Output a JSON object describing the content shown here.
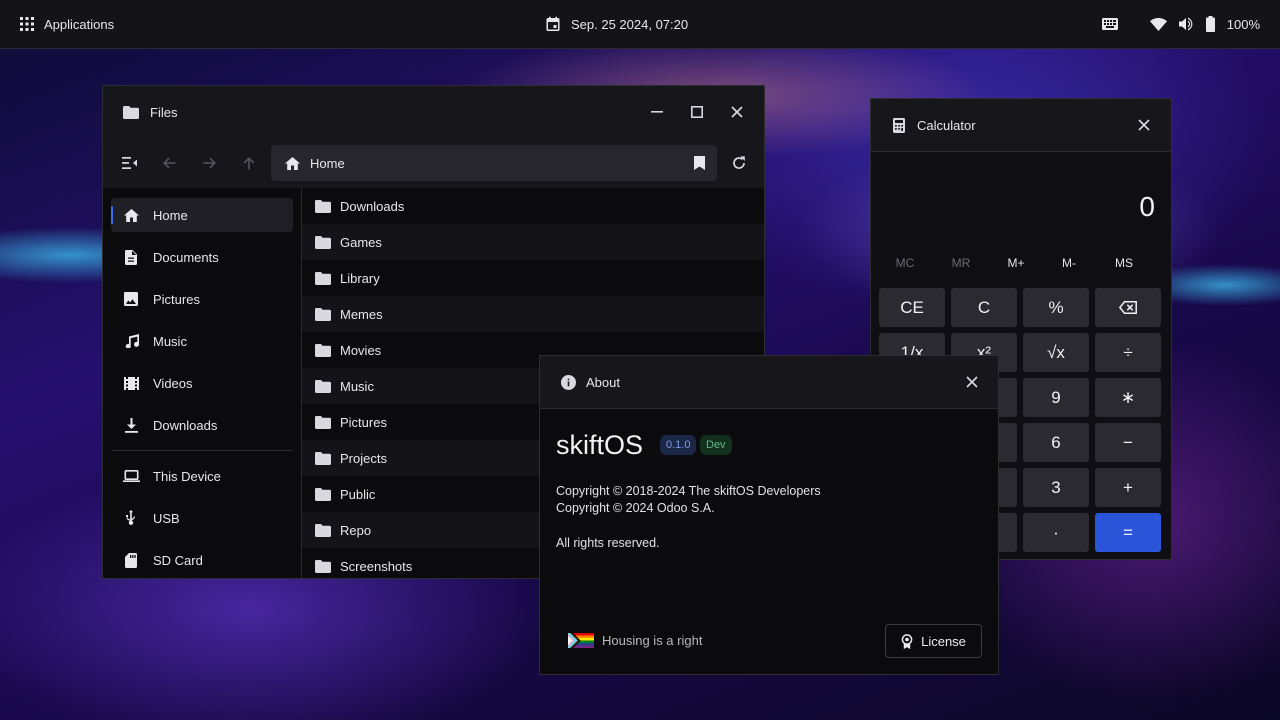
{
  "taskbar": {
    "apps_label": "Applications",
    "datetime": "Sep. 25 2024, 07:20",
    "battery": "100%"
  },
  "files": {
    "title": "Files",
    "path": "Home",
    "sidebar": [
      {
        "label": "Home",
        "icon": "home-icon",
        "active": true
      },
      {
        "label": "Documents",
        "icon": "document-icon"
      },
      {
        "label": "Pictures",
        "icon": "image-icon"
      },
      {
        "label": "Music",
        "icon": "music-icon"
      },
      {
        "label": "Videos",
        "icon": "video-icon"
      },
      {
        "label": "Downloads",
        "icon": "download-icon"
      },
      {
        "label": "This Device",
        "icon": "laptop-icon"
      },
      {
        "label": "USB",
        "icon": "usb-icon"
      },
      {
        "label": "SD Card",
        "icon": "sd-card-icon"
      }
    ],
    "entries": [
      "Downloads",
      "Games",
      "Library",
      "Memes",
      "Movies",
      "Music",
      "Pictures",
      "Projects",
      "Public",
      "Repo",
      "Screenshots"
    ]
  },
  "calculator": {
    "title": "Calculator",
    "display": "0",
    "memory": [
      "MC",
      "MR",
      "M+",
      "M-",
      "MS"
    ],
    "keys": {
      "ce": "CE",
      "c": "C",
      "percent": "%",
      "reciprocal": "1/x",
      "square": "x²",
      "sqrt": "√x",
      "divide": "÷",
      "nine": "9",
      "multiply": "∗",
      "six": "6",
      "minus": "−",
      "three": "3",
      "plus": "+",
      "dot": "·",
      "equals": "="
    },
    "accent": "#2b55d8"
  },
  "about": {
    "title": "About",
    "name": "skiftOS",
    "version": "0.1.0",
    "channel": "Dev",
    "copyright1": "Copyright © 2018-2024 The skiftOS Developers",
    "copyright2": "Copyright © 2024 Odoo S.A.",
    "rights": "All rights reserved.",
    "slogan": "Housing is a right",
    "license_label": "License"
  }
}
